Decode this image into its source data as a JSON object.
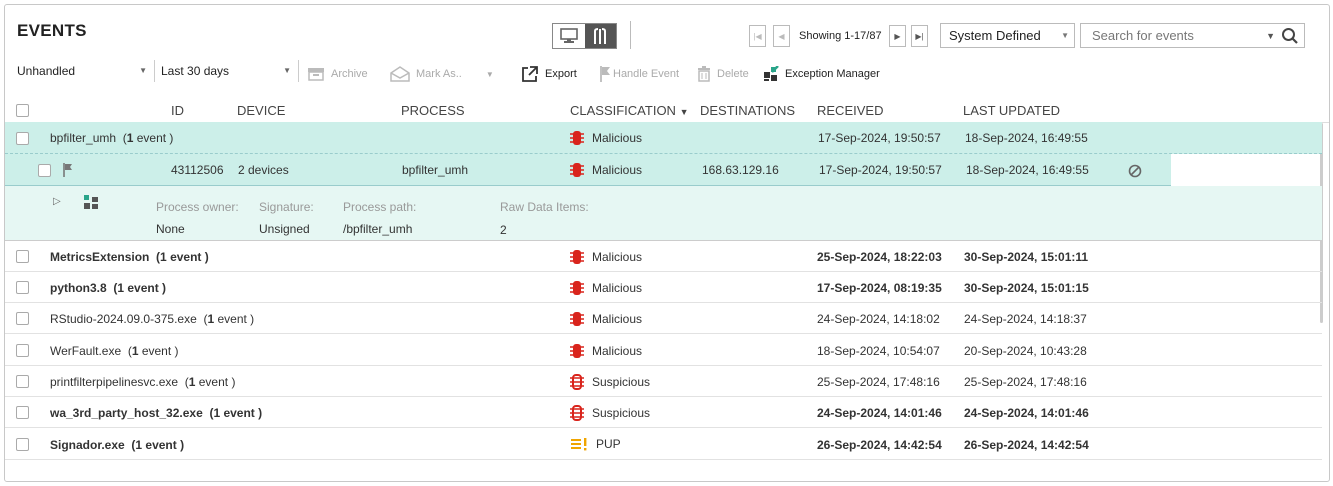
{
  "header": {
    "title": "EVENTS"
  },
  "pager": {
    "showing": "Showing 1-17/87"
  },
  "view_filter": {
    "selected": "System Defined"
  },
  "search": {
    "placeholder": "Search for events"
  },
  "filters": {
    "status": "Unhandled",
    "range": "Last 30 days"
  },
  "toolbar": {
    "archive": "Archive",
    "mark_as": "Mark As..",
    "export": "Export",
    "handle_event": "Handle Event",
    "delete": "Delete",
    "exception_manager": "Exception Manager"
  },
  "columns": {
    "id": "ID",
    "device": "DEVICE",
    "process": "PROCESS",
    "classification": "CLASSIFICATION",
    "destinations": "DESTINATIONS",
    "received": "RECEIVED",
    "last_updated": "LAST UPDATED"
  },
  "expanded_group": {
    "name": "bpfilter_umh",
    "count_prefix": "(",
    "count": "1",
    "count_suffix": " event )",
    "classification": "Malicious",
    "received": "17-Sep-2024, 19:50:57",
    "last_updated": "18-Sep-2024, 16:49:55",
    "event": {
      "id": "43112506",
      "device": "2 devices",
      "process": "bpfilter_umh",
      "classification": "Malicious",
      "destinations": "168.63.129.16",
      "received": "17-Sep-2024, 19:50:57",
      "last_updated": "18-Sep-2024, 16:49:55"
    },
    "details": {
      "process_owner_label": "Process owner:",
      "process_owner": "None",
      "signature_label": "Signature:",
      "signature": "Unsigned",
      "process_path_label": "Process path:",
      "process_path": "/bpfilter_umh",
      "raw_data_label": "Raw Data Items:",
      "raw_data": "2"
    }
  },
  "rows": [
    {
      "name": "MetricsExtension",
      "count_prefix": "(",
      "count": "1",
      "count_suffix": " event )",
      "classification": "Malicious",
      "received": "25-Sep-2024, 18:22:03",
      "last_updated": "30-Sep-2024, 15:01:11"
    },
    {
      "name": "python3.8",
      "count_prefix": "(",
      "count": "1",
      "count_suffix": " event )",
      "classification": "Malicious",
      "received": "17-Sep-2024, 08:19:35",
      "last_updated": "30-Sep-2024, 15:01:15"
    },
    {
      "name": "RStudio-2024.09.0-375.exe",
      "count_prefix": "(",
      "count": "1",
      "count_suffix": " event )",
      "classification": "Malicious",
      "received": "24-Sep-2024, 14:18:02",
      "last_updated": "24-Sep-2024, 14:18:37"
    },
    {
      "name": "WerFault.exe",
      "count_prefix": "(",
      "count": "1",
      "count_suffix": " event )",
      "classification": "Malicious",
      "received": "18-Sep-2024, 10:54:07",
      "last_updated": "20-Sep-2024, 10:43:28"
    },
    {
      "name": "printfilterpipelinesvc.exe",
      "count_prefix": "(",
      "count": "1",
      "count_suffix": " event )",
      "classification": "Suspicious",
      "received": "25-Sep-2024, 17:48:16",
      "last_updated": "25-Sep-2024, 17:48:16"
    },
    {
      "name": "wa_3rd_party_host_32.exe",
      "count_prefix": "(",
      "count": "1",
      "count_suffix": " event )",
      "classification": "Suspicious",
      "received": "24-Sep-2024, 14:01:46",
      "last_updated": "24-Sep-2024, 14:01:46"
    },
    {
      "name": "Signador.exe",
      "count_prefix": "(",
      "count": "1",
      "count_suffix": " event )",
      "classification": "PUP",
      "received": "26-Sep-2024, 14:42:54",
      "last_updated": "26-Sep-2024, 14:42:54"
    }
  ],
  "colors": {
    "malicious": "#d9241c",
    "pup": "#f0a500",
    "highlight": "#ccefe9",
    "details_bg": "#e6f7f3",
    "exception_accent": "#2aa58a"
  }
}
